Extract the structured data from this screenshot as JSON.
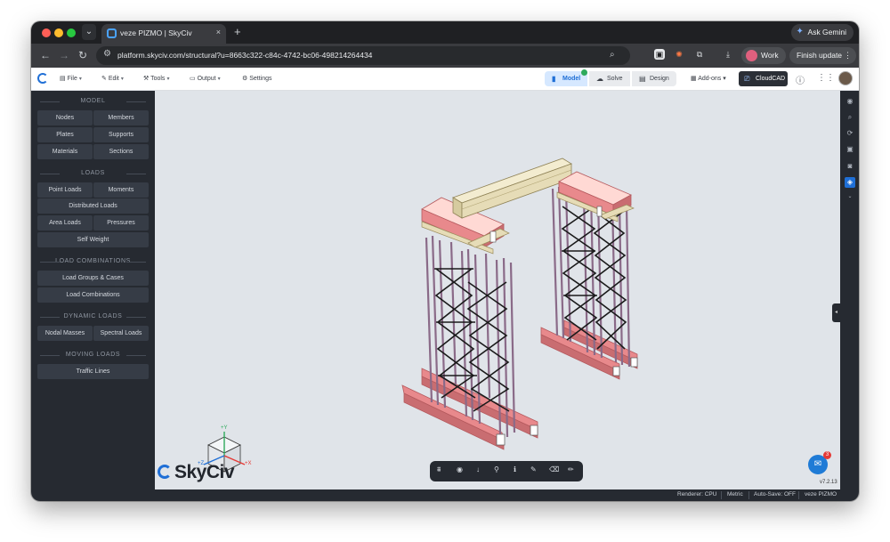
{
  "browser": {
    "tab_title": "veze PIZMO | SkyCiv",
    "tab_close": "×",
    "new_tab": "+",
    "url": "platform.skyciv.com/structural?u=8663c322-c84c-4742-bc06-498214264434",
    "gemini_label": "Ask Gemini",
    "profile_label": "Work",
    "update_label": "Finish update"
  },
  "app_menu": {
    "file": "File",
    "edit": "Edit",
    "tools": "Tools",
    "output": "Output",
    "settings": "Settings"
  },
  "workflow": {
    "model": "Model",
    "solve": "Solve",
    "design": "Design"
  },
  "toolbar_right": {
    "addons": "Add-ons",
    "cloudcad": "CloudCAD"
  },
  "left_panel": {
    "model_heading": "MODEL",
    "model_items": [
      "Nodes",
      "Members",
      "Plates",
      "Supports",
      "Materials",
      "Sections"
    ],
    "loads_heading": "LOADS",
    "loads_items": [
      "Point Loads",
      "Moments",
      "Distributed Loads",
      "Area Loads",
      "Pressures",
      "Self Weight"
    ],
    "combos_heading": "LOAD COMBINATIONS",
    "combos_items": [
      "Load Groups & Cases",
      "Load Combinations"
    ],
    "dynamic_heading": "DYNAMIC LOADS",
    "dynamic_items": [
      "Nodal Masses",
      "Spectral Loads"
    ],
    "moving_heading": "MOVING LOADS",
    "moving_items": [
      "Traffic Lines"
    ]
  },
  "canvas": {
    "axis_y": "+Y",
    "axis_x": "+X",
    "axis_z": "+Z",
    "brand": "SkyCiv",
    "version": "v7.2.13",
    "chat_badge": "3"
  },
  "status_bar": {
    "renderer": "Renderer: CPU",
    "units": "Metric",
    "autosave": "Auto-Save: OFF",
    "project": "veze PIZMO"
  },
  "colors": {
    "accent": "#1f6fd6",
    "panel_bg": "#262a31",
    "canvas_bg": "#e0e4e9",
    "beam_pink": "#e8898c",
    "beam_cream": "#e6dcb7",
    "tower_mauve": "#c6a8c5"
  },
  "icons": {
    "back": "arrow-left-icon",
    "forward": "arrow-right-icon",
    "reload": "reload-icon",
    "zoom": "zoom-icon",
    "star": "star-icon",
    "extensions": "puzzle-icon",
    "download": "download-icon",
    "help": "help-icon",
    "apps": "grid-icon"
  }
}
